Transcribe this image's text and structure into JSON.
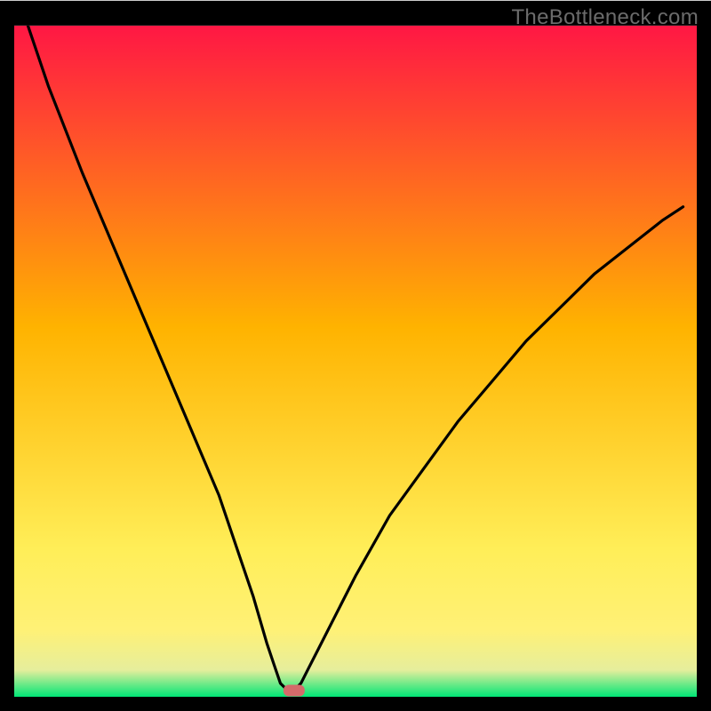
{
  "watermark": "TheBottleneck.com",
  "chart_data": {
    "type": "line",
    "title": "",
    "xlabel": "",
    "ylabel": "",
    "xlim": [
      0,
      100
    ],
    "ylim": [
      0,
      100
    ],
    "series": [
      {
        "name": "bottleneck-curve",
        "x": [
          2,
          5,
          10,
          15,
          20,
          25,
          30,
          33,
          35,
          37,
          38,
          39,
          40,
          41,
          42,
          43,
          45,
          50,
          55,
          60,
          65,
          70,
          75,
          80,
          85,
          90,
          95,
          98
        ],
        "values": [
          100,
          91,
          78,
          66,
          54,
          42,
          30,
          21,
          15,
          8,
          5,
          2,
          1,
          1,
          2,
          4,
          8,
          18,
          27,
          34,
          41,
          47,
          53,
          58,
          63,
          67,
          71,
          73
        ]
      }
    ],
    "marker": {
      "x": 41,
      "y": 1
    },
    "gradient_background": {
      "top": "#ff1744",
      "mid1": "#ffb300",
      "mid2": "#ffee58",
      "low1": "#fff176",
      "low2": "#e6ee9c",
      "bottom": "#00e676"
    },
    "plot_frame_fraction": {
      "x0": 0.02,
      "y0": 0.036,
      "x1": 0.98,
      "y1": 0.98
    },
    "frame_stroke_width": 28
  }
}
